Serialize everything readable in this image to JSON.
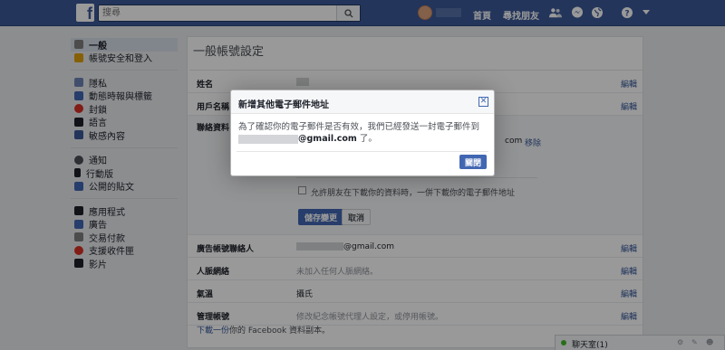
{
  "topbar": {
    "search_placeholder": "搜尋",
    "nav_home": "首頁",
    "nav_find_friends": "尋找朋友",
    "icons": [
      "friends-icon",
      "messages-icon",
      "globe-icon",
      "help-icon",
      "dropdown-icon"
    ]
  },
  "sidebar": {
    "groups": [
      [
        {
          "label": "一般",
          "icon": "gear-icon",
          "active": true
        },
        {
          "label": "帳號安全和登入",
          "icon": "shield-icon",
          "active": false
        }
      ],
      [
        {
          "label": "隱私",
          "icon": "lock-icon",
          "active": false
        },
        {
          "label": "動態時報與標籤",
          "icon": "timeline-icon",
          "active": false
        },
        {
          "label": "封鎖",
          "icon": "block-icon",
          "active": false
        },
        {
          "label": "語言",
          "icon": "language-icon",
          "active": false
        },
        {
          "label": "敏感內容",
          "icon": "sensitive-icon",
          "active": false
        }
      ],
      [
        {
          "label": "通知",
          "icon": "globe-icon",
          "active": false
        },
        {
          "label": "行動版",
          "icon": "mobile-icon",
          "active": false
        },
        {
          "label": "公開的貼文",
          "icon": "rss-icon",
          "active": false
        }
      ],
      [
        {
          "label": "應用程式",
          "icon": "apps-icon",
          "active": false
        },
        {
          "label": "廣告",
          "icon": "ads-icon",
          "active": false
        },
        {
          "label": "交易付款",
          "icon": "payments-icon",
          "active": false
        },
        {
          "label": "支援收件匣",
          "icon": "support-icon",
          "active": false
        },
        {
          "label": "影片",
          "icon": "video-icon",
          "active": false
        }
      ]
    ]
  },
  "main": {
    "title": "一般帳號設定",
    "edit_label": "編輯",
    "rows": {
      "name": "姓名",
      "username": "用戶名稱",
      "contact": "聯絡資料",
      "remove": "移除",
      "email_suffix_partial": "com",
      "allow_download": "允許朋友在下載你的資料時，一併下載你的電子郵件地址",
      "save_changes": "儲存變更",
      "cancel": "取消",
      "ad_contact": "廣告帳號聯絡人",
      "ad_contact_value": "@gmail.com",
      "memorial": "人脈網絡",
      "memorial_value": "未加入任何人脈網絡。",
      "temperature": "氣溫",
      "temperature_value": "攝氏",
      "manage_account": "管理帳號",
      "manage_account_value": "修改紀念帳號代理人設定，或停用帳號。"
    },
    "download_link": "下載一份",
    "download_rest": "你的 Facebook 資料副本。"
  },
  "dialog": {
    "title": "新增其他電子郵件地址",
    "body_line1": "為了確認你的電子郵件是否有效，我們已經發送一封電子郵件到",
    "email_domain": "@gmail.com",
    "body_end": " 了。",
    "close_button": "關閉"
  },
  "chat": {
    "label": "聊天室(1)"
  }
}
